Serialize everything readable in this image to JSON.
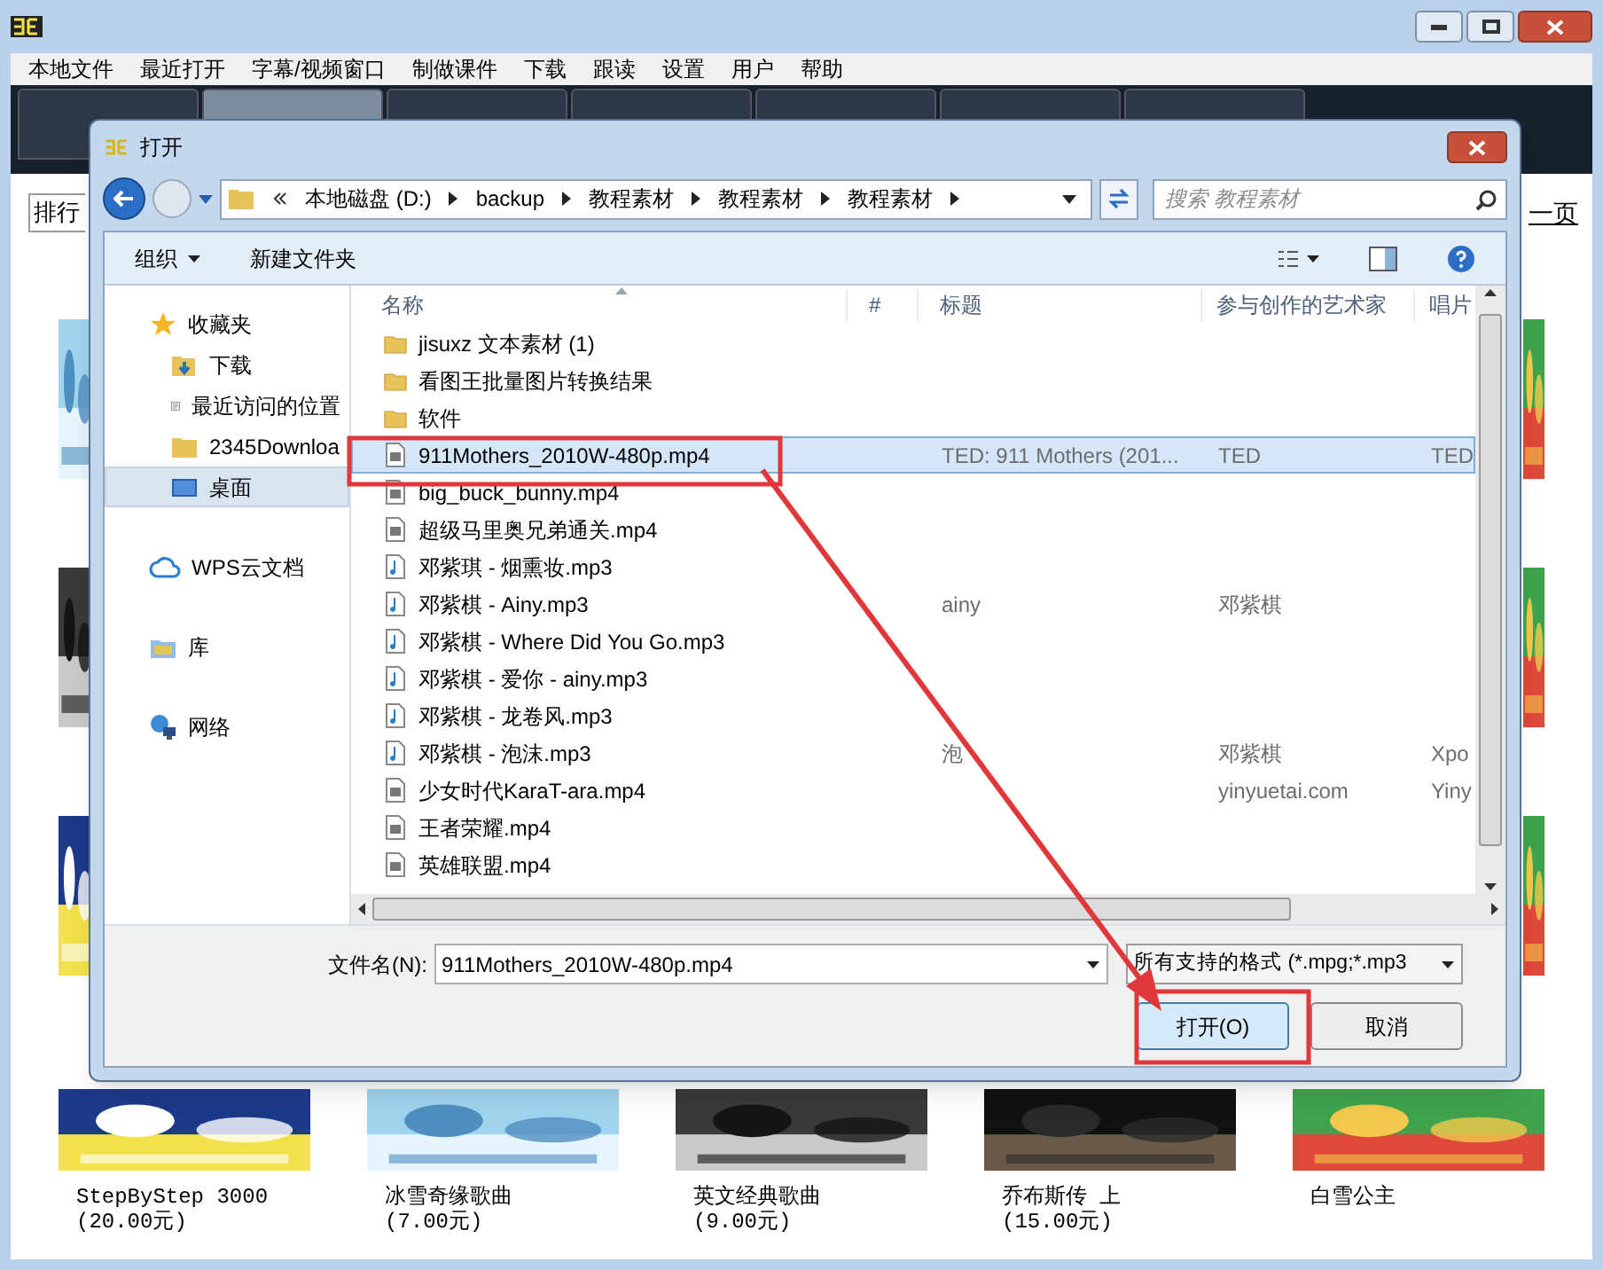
{
  "app": {
    "menu": [
      "本地文件",
      "最近打开",
      "字幕/视频窗口",
      "制做课件",
      "下载",
      "跟读",
      "设置",
      "用户",
      "帮助"
    ],
    "tabs": [
      {
        "selected": false
      },
      {
        "selected": true
      },
      {
        "selected": false
      },
      {
        "selected": false
      },
      {
        "selected": false
      },
      {
        "selected": false
      },
      {
        "selected": false
      }
    ],
    "toolbar": {
      "field_value": "排行",
      "next_link": "一页"
    },
    "products": [
      {
        "name": "StepByStep 3000",
        "price": "(20.00元)",
        "kind": "blue"
      },
      {
        "name": "冰雪奇缘歌曲",
        "price": "(7.00元)",
        "kind": "ice"
      },
      {
        "name": "英文经典歌曲",
        "price": "(9.00元)",
        "kind": "dark"
      },
      {
        "name": "乔布斯传 上",
        "price": "(15.00元)",
        "kind": "black"
      },
      {
        "name": "白雪公主",
        "kind": "cartoon"
      }
    ]
  },
  "dialog": {
    "title": "打开",
    "breadcrumb": [
      "本地磁盘 (D:)",
      "backup",
      "教程素材",
      "教程素材",
      "教程素材"
    ],
    "search": {
      "placeholder": "搜索 教程素材"
    },
    "toolbar": [
      "组织",
      "新建文件夹"
    ],
    "nav": [
      {
        "label": "收藏夹",
        "selected": false,
        "children": [
          {
            "label": "下载",
            "selected": false
          },
          {
            "label": "最近访问的位置",
            "selected": false
          },
          {
            "label": "2345Downloa",
            "selected": false
          },
          {
            "label": "桌面",
            "selected": true
          }
        ]
      },
      {
        "label": "WPS云文档",
        "selected": false
      },
      {
        "label": "库",
        "selected": false
      },
      {
        "label": "网络",
        "selected": false
      }
    ],
    "columns": [
      "名称",
      "#",
      "标题",
      "参与创作的艺术家",
      "唱片"
    ],
    "files": [
      {
        "name": "jisuxz 文本素材 (1)",
        "kind": "folder",
        "selected": false
      },
      {
        "name": "看图王批量图片转换结果",
        "kind": "folder",
        "selected": false
      },
      {
        "name": "软件",
        "kind": "folder",
        "selected": false
      },
      {
        "name": "911Mothers_2010W-480p.mp4",
        "kind": "video",
        "selected": true,
        "title": "TED: 911 Mothers (201...",
        "artist": "TED",
        "album": "TED"
      },
      {
        "name": "big_buck_bunny.mp4",
        "kind": "video",
        "selected": false
      },
      {
        "name": "超级马里奥兄弟通关.mp4",
        "kind": "video",
        "selected": false
      },
      {
        "name": "邓紫琪 - 烟熏妆.mp3",
        "kind": "audio",
        "selected": false
      },
      {
        "name": "邓紫棋 - Ainy.mp3",
        "kind": "audio",
        "selected": false,
        "title": "ainy",
        "artist": "邓紫棋"
      },
      {
        "name": "邓紫棋 - Where Did You Go.mp3",
        "kind": "audio",
        "selected": false
      },
      {
        "name": "邓紫棋 - 爱你 - ainy.mp3",
        "kind": "audio",
        "selected": false
      },
      {
        "name": "邓紫棋 - 龙卷风.mp3",
        "kind": "audio",
        "selected": false
      },
      {
        "name": "邓紫棋 - 泡沫.mp3",
        "kind": "audio",
        "selected": false,
        "title": "泡",
        "artist": "邓紫棋",
        "album": "Xpo"
      },
      {
        "name": "少女时代KaraT-ara.mp4",
        "kind": "video",
        "selected": false,
        "artist": "yinyuetai.com",
        "album": "Yiny"
      },
      {
        "name": "王者荣耀.mp4",
        "kind": "video",
        "selected": false
      },
      {
        "name": "英雄联盟.mp4",
        "kind": "video",
        "selected": false
      }
    ],
    "filename_label": "文件名(N):",
    "filename": "911Mothers_2010W-480p.mp4",
    "filter": "所有支持的格式 (*.mpg;*.mp3",
    "buttons": [
      {
        "label": "打开(O)",
        "kind": "primary"
      },
      {
        "label": "取消",
        "kind": "normal"
      }
    ]
  }
}
